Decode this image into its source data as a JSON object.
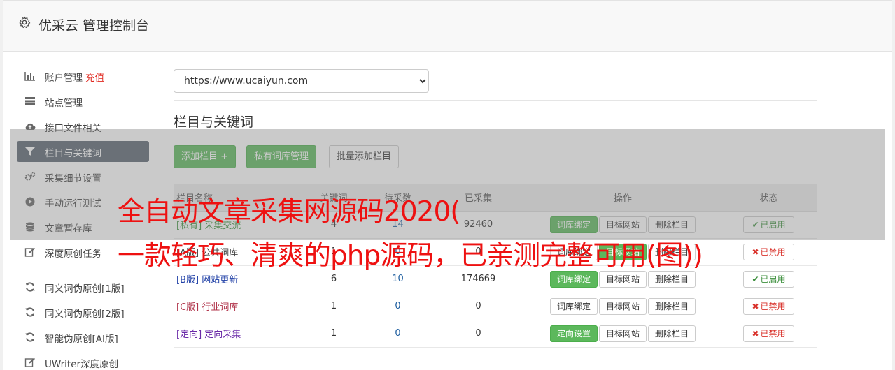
{
  "header": {
    "title": "优采云 管理控制台",
    "icon": "gear-icon"
  },
  "sidebar": {
    "items": [
      {
        "label": "账户管理",
        "extra": "充值",
        "icon": "bar-chart-icon"
      },
      {
        "label": "站点管理",
        "icon": "server-icon"
      },
      {
        "label": "接口文件相关",
        "icon": "cloud-upload-icon"
      },
      {
        "label": "栏目与关键词",
        "icon": "filter-icon",
        "active": true
      },
      {
        "label": "采集细节设置",
        "icon": "cogs-icon"
      },
      {
        "label": "手动运行测试",
        "icon": "play-circle-icon"
      },
      {
        "label": "文章暂存库",
        "icon": "database-icon"
      },
      {
        "label": "深度原创任务",
        "icon": "edit-icon"
      },
      {
        "label": "同义词伪原创[1版]",
        "icon": "refresh-icon"
      },
      {
        "label": "同义词伪原创[2版]",
        "icon": "refresh-icon"
      },
      {
        "label": "智能伪原创[AI版]",
        "icon": "refresh-icon"
      },
      {
        "label": "UWriter深度原创",
        "icon": "edit-icon"
      }
    ]
  },
  "site_select": {
    "value": "https://www.ucaiyun.com"
  },
  "section_title": "栏目与关键词",
  "toolbar": {
    "add_label": "添加栏目 +",
    "private_label": "私有词库管理",
    "batch_label": "批量添加栏目"
  },
  "table": {
    "headers": [
      "栏目名称",
      "关键词",
      "待采数",
      "已采集",
      "操作",
      "状态"
    ],
    "rows": [
      {
        "tag": "[私有]",
        "name": "采集交流",
        "kw": "4",
        "pending": "14",
        "done": "92460",
        "op1": "词库绑定",
        "op2": "目标网站",
        "op3": "删除栏目",
        "status": "已启用",
        "enabled": true
      },
      {
        "tag": "[A版]",
        "name": "公共词库",
        "kw": "1",
        "pending": "0",
        "done": "0",
        "op1": "词库绑定",
        "op2": "目标网站",
        "op3": "删除栏目",
        "status": "已禁用",
        "enabled": false
      },
      {
        "tag": "[B版]",
        "name": "网站更新",
        "kw": "6",
        "pending": "10",
        "done": "174669",
        "op1": "词库绑定",
        "op2": "目标网站",
        "op3": "删除栏目",
        "status": "已启用",
        "enabled": true
      },
      {
        "tag": "[C版]",
        "name": "行业词库",
        "kw": "1",
        "pending": "0",
        "done": "0",
        "op1": "词库绑定",
        "op2": "目标网站",
        "op3": "删除栏目",
        "status": "已禁用",
        "enabled": false
      },
      {
        "tag": "[定向]",
        "name": "定向采集",
        "kw": "1",
        "pending": "0",
        "done": "0",
        "op1": "定向设置",
        "op2": "目标网站",
        "op3": "删除栏目",
        "status": "已禁用",
        "enabled": false
      }
    ]
  },
  "watermark": {
    "line1": "全自动文章采集网源码2020(",
    "line2": "一款轻巧、清爽的php源码，已亲测完整可用(图))"
  }
}
